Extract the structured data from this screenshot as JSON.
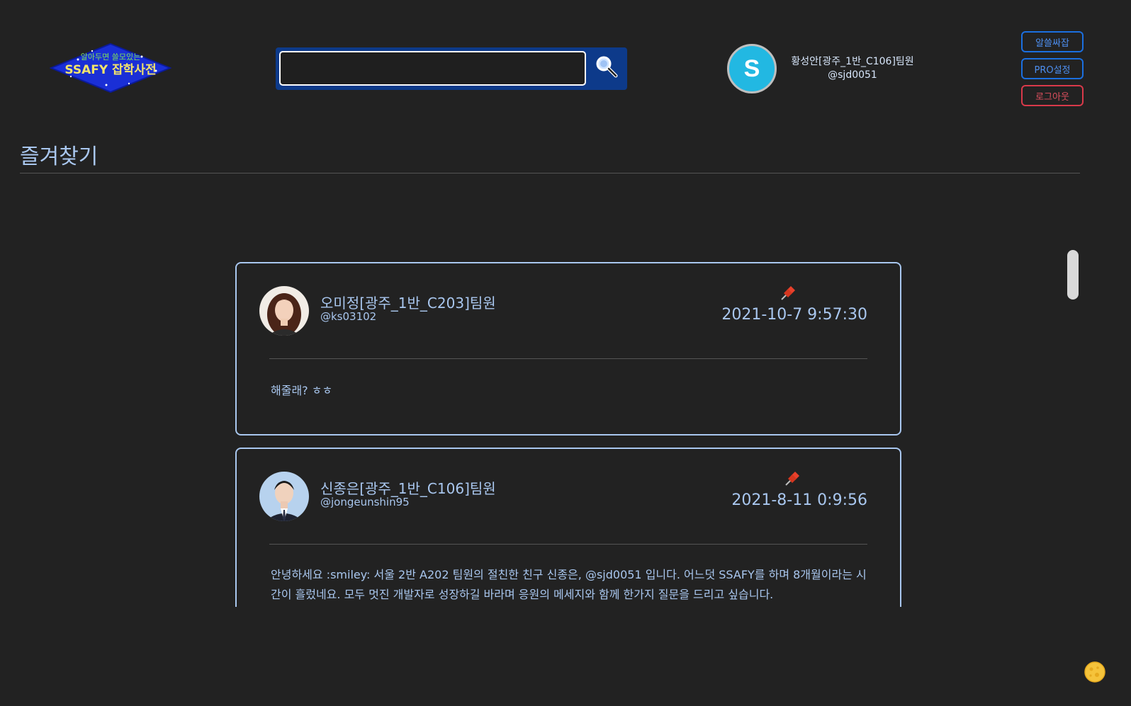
{
  "header": {
    "logo": {
      "tagline": "알아두면 쓸모있는",
      "brand": "SSAFY 잡학사전"
    },
    "search": {
      "value": "",
      "placeholder": "",
      "button_icon": "search-icon"
    },
    "profile": {
      "initial": "S",
      "name": "황성안[광주_1반_C106]팀원",
      "handle": "@sjd0051",
      "avatar_color": "#22b8e2"
    },
    "buttons": {
      "alssal": "알쓸싸잡",
      "pro": "PRO설정",
      "logout": "로그아웃"
    }
  },
  "page": {
    "title": "즐겨찾기"
  },
  "bookmarks": [
    {
      "author": "오미정[광주_1반_C203]팀원",
      "handle": "@ks03102",
      "date": "2021-10-7 9:57:30",
      "pin_icon": "pushpin-icon",
      "body": "해줄래? ㅎㅎ"
    },
    {
      "author": "신종은[광주_1반_C106]팀원",
      "handle": "@jongeunshin95",
      "date": "2021-8-11 0:9:56",
      "pin_icon": "pushpin-icon",
      "body": "안녕하세요 :smiley: 서울 2반 A202 팀원의 절친한 친구 신종은, @sjd0051 입니다. 어느덧 SSAFY를 하며 8개월이라는 시간이 흘렀네요. 모두 멋진 개발자로 성장하길 바라며 응원의 메세지와 함께 한가지 질문을 드리고 싶습니다."
    }
  ],
  "colors": {
    "background": "#222222",
    "accent_text": "#a9c7ef",
    "search_frame": "#0d3a8a",
    "button_blue": "#1b6fe0",
    "button_red": "#d9394a",
    "pin_red": "#e8402b"
  }
}
